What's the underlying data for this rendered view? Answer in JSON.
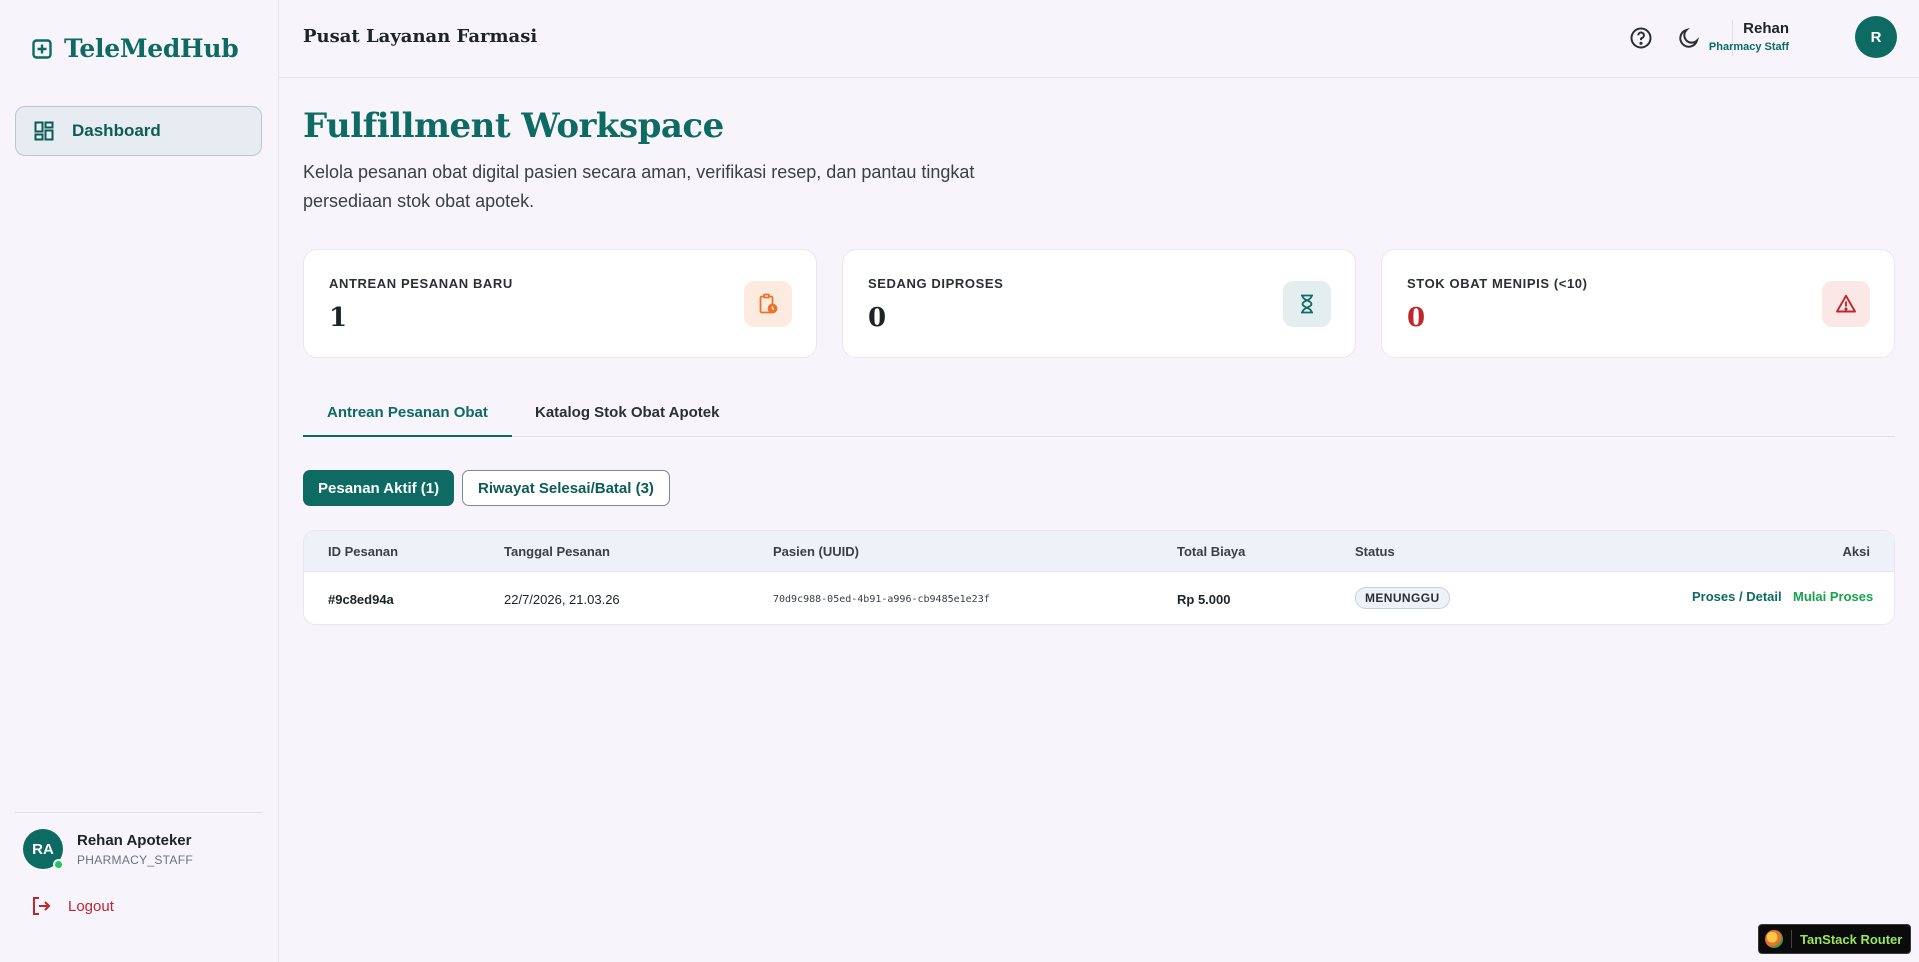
{
  "brand": {
    "name": "TeleMedHub"
  },
  "sidebar": {
    "items": [
      {
        "label": "Dashboard",
        "icon": "dashboard-grid-icon",
        "active": true
      }
    ],
    "user": {
      "initials": "RA",
      "name": "Rehan Apoteker",
      "role": "PHARMACY_STAFF"
    },
    "logout_label": "Logout"
  },
  "header": {
    "title": "Pusat Layanan Farmasi",
    "user": {
      "name": "Rehan",
      "role": "Pharmacy Staff",
      "initial": "R"
    }
  },
  "page": {
    "title": "Fulfillment Workspace",
    "description": "Kelola pesanan obat digital pasien secara aman, verifikasi resep, dan pantau tingkat persediaan stok obat apotek."
  },
  "stats": [
    {
      "label": "ANTREAN PESANAN BARU",
      "value": "1",
      "icon": "clipboard-clock-icon",
      "accent": "#e8742a"
    },
    {
      "label": "SEDANG DIPROSES",
      "value": "0",
      "icon": "hourglass-icon",
      "accent": "#0d6b63"
    },
    {
      "label": "STOK OBAT MENIPIS (<10)",
      "value": "0",
      "icon": "warning-triangle-icon",
      "accent": "#c0262d"
    }
  ],
  "tabs": [
    {
      "label": "Antrean Pesanan Obat",
      "active": true
    },
    {
      "label": "Katalog Stok Obat Apotek",
      "active": false
    }
  ],
  "filters": [
    {
      "label": "Pesanan Aktif (1)",
      "active": true
    },
    {
      "label": "Riwayat Selesai/Batal (3)",
      "active": false
    }
  ],
  "table": {
    "columns": [
      "ID Pesanan",
      "Tanggal Pesanan",
      "Pasien (UUID)",
      "Total Biaya",
      "Status",
      "Aksi"
    ],
    "rows": [
      {
        "id": "#9c8ed94a",
        "date": "22/7/2026, 21.03.26",
        "patient": "70d9c988-05ed-4b91-a996-cb9485e1e23f",
        "total": "Rp 5.000",
        "status": "MENUNGGU",
        "actions": [
          "Proses / Detail",
          "Mulai Proses"
        ]
      }
    ]
  },
  "devtools": {
    "label": "TanStack Router"
  },
  "colors": {
    "primary": "#0d6b63",
    "danger": "#c0262d",
    "warning": "#e8742a",
    "success": "#16a34a"
  }
}
